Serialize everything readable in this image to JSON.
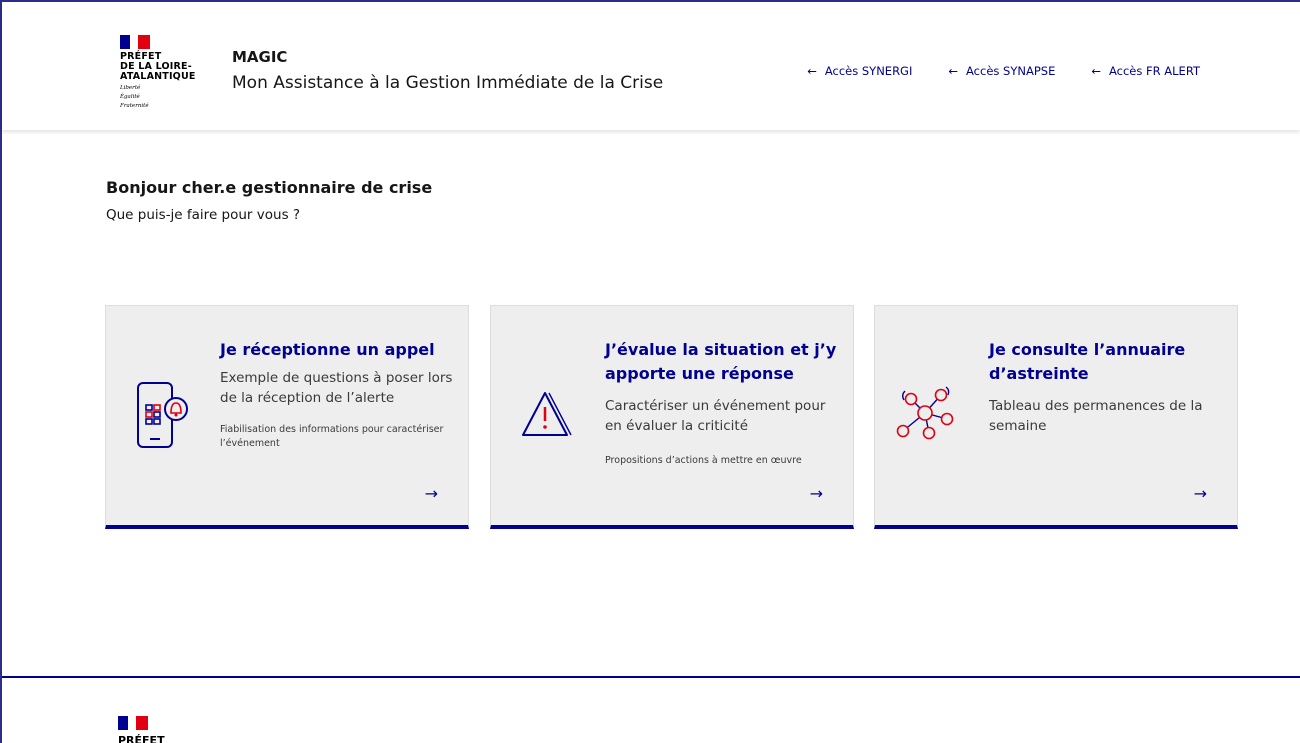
{
  "header": {
    "logo": {
      "lines": [
        "PRÉFET",
        "DE LA LOIRE-",
        "ATALANTIQUE"
      ],
      "motto": [
        "Liberté",
        "Égalité",
        "Fraternité"
      ]
    },
    "site_name": "MAGIC",
    "tagline": "Mon Assistance à la Gestion Immédiate de la Crise",
    "tools": [
      {
        "label": "Accès SYNERGI",
        "icon": "arrow-left-icon"
      },
      {
        "label": "Accès SYNAPSE",
        "icon": "arrow-left-icon"
      },
      {
        "label": "Accès FR ALERT",
        "icon": "arrow-left-icon"
      }
    ]
  },
  "main": {
    "greeting": "Bonjour cher.e gestionnaire de crise",
    "subtitle": "Que puis-je faire pour vous ?",
    "cards": [
      {
        "title": "Je réceptionne un appel",
        "description": "Exemple de questions à poser lors de la réception de l’alerte",
        "detail": "Fiabilisation des informations pour caractériser l’événement",
        "icon": "phone-alert-icon"
      },
      {
        "title": "J’évalue la situation et j’y apporte une réponse",
        "description": "Caractériser un événement pour en évaluer la criticité",
        "detail": "Propositions d’actions à mettre en œuvre",
        "icon": "warning-triangle-icon"
      },
      {
        "title": "Je consulte l’annuaire d’astreinte",
        "description": "Tableau des permanences de la semaine",
        "detail": "",
        "icon": "network-people-icon"
      }
    ],
    "card_arrow": "→"
  },
  "footer": {
    "logo_text": "PRÉFET"
  },
  "colors": {
    "primary": "#000091",
    "accent_red": "#e1000f",
    "card_bg": "#eeeeee"
  }
}
